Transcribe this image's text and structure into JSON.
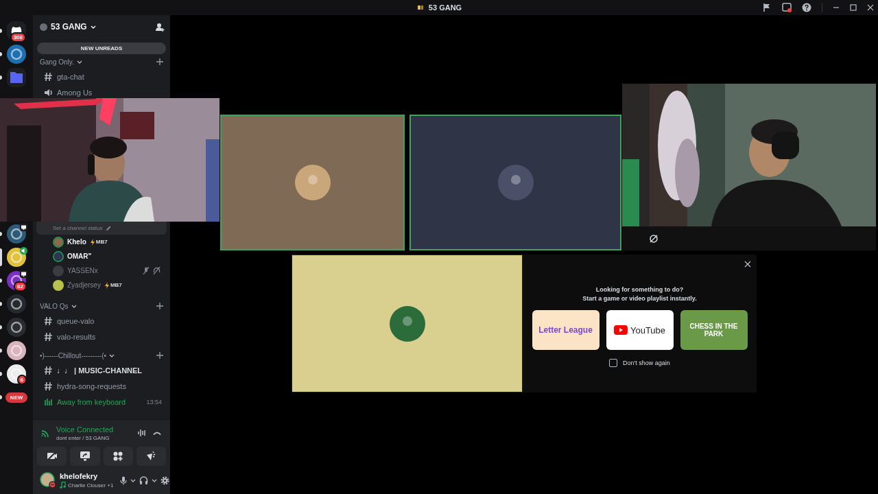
{
  "window": {
    "title": "53 GANG"
  },
  "servers_top": [
    {
      "kind": "home",
      "badge": "306",
      "selected": false
    },
    {
      "kind": "logo",
      "color": "#1e6fb0",
      "selected": false
    },
    {
      "kind": "folder",
      "color": "#5865f2",
      "selected": false
    }
  ],
  "servers_bottom": [
    {
      "kind": "logo",
      "color": "#2c5a78",
      "indicator": {
        "kind": "screen"
      },
      "selected": false
    },
    {
      "kind": "logo",
      "color": "#e2c23a",
      "indicator": {
        "kind": "voice"
      },
      "selected": true
    },
    {
      "kind": "logo",
      "color": "#7b2fc2",
      "indicator": {
        "kind": "screen"
      },
      "badge": "62",
      "selected": false
    },
    {
      "kind": "logo",
      "color": "#25282e",
      "selected": false
    },
    {
      "kind": "logo",
      "color": "#2a2c31",
      "selected": false
    },
    {
      "kind": "logo",
      "color": "#d9b3bd",
      "selected": false
    },
    {
      "kind": "logo",
      "color": "#ececec",
      "badge": "6",
      "selected": false
    },
    {
      "kind": "new",
      "label": "NEW",
      "selected": false
    }
  ],
  "server_header": {
    "name": "53 GANG",
    "banner": "NEW UNREADS"
  },
  "channels_top": [
    {
      "kind": "category",
      "name": "Gang Only."
    },
    {
      "kind": "text",
      "name": "gta-chat",
      "unread": false
    },
    {
      "kind": "voice",
      "name": "Among Us",
      "unread": false
    }
  ],
  "voice_channel": {
    "status": "Set a channel status",
    "members": [
      {
        "name": "Khelo",
        "badge": "MB7",
        "speaking": true,
        "color": "#8a6a4a",
        "muted": false,
        "deafened": false
      },
      {
        "name": "OMAR\"",
        "speaking": true,
        "color": "#2e3550",
        "muted": false,
        "deafened": false
      },
      {
        "name": "YASSENx",
        "speaking": false,
        "color": "#3a3c42",
        "muted": true,
        "deafened": true
      },
      {
        "name": "Zyadjersey",
        "badge": "MB7",
        "speaking": false,
        "color": "#b7c04a",
        "muted": false,
        "deafened": false
      }
    ]
  },
  "channels_bottom": [
    {
      "kind": "category",
      "name": "VALO Qs"
    },
    {
      "kind": "text",
      "name": "queue-valo",
      "unread": false
    },
    {
      "kind": "text",
      "name": "valo-results",
      "unread": false
    },
    {
      "kind": "category",
      "name": "•)------Chillout---------(•"
    },
    {
      "kind": "text",
      "name": "♩♩ | MUSIC-CHANNEL",
      "unread": true
    },
    {
      "kind": "text",
      "name": "hydra-song-requests",
      "unread": false
    },
    {
      "kind": "afk",
      "name": "Away from keyboard",
      "time": "13:54",
      "unread": false
    }
  ],
  "voice_panel": {
    "title": "Voice Connected",
    "location": "dont enter / 53 GANG"
  },
  "user_panel": {
    "name": "khelofekry",
    "activity": "Charlie Clouser +1"
  },
  "tiles": [
    {
      "color": "#7f6a55",
      "avatar": {
        "color": "#c9a77a"
      },
      "speaking": true
    },
    {
      "color": "#2f3447",
      "avatar": {
        "color": "#4a5068"
      },
      "speaking": true
    }
  ],
  "tiles_row2": [
    {
      "color": "#d9d08f",
      "avatar": {
        "color": "#2c6b3a"
      },
      "speaking": false
    }
  ],
  "activity_panel": {
    "heading": "Looking for something to do?",
    "subheading": "Start a game or video playlist instantly.",
    "activities": [
      {
        "kind": "letter",
        "label": "Letter League"
      },
      {
        "kind": "youtube",
        "label": "YouTube"
      },
      {
        "kind": "chess",
        "label": "CHESS IN THE PARK"
      }
    ],
    "dont_show": {
      "label": "Don't show again",
      "checked": false
    }
  }
}
